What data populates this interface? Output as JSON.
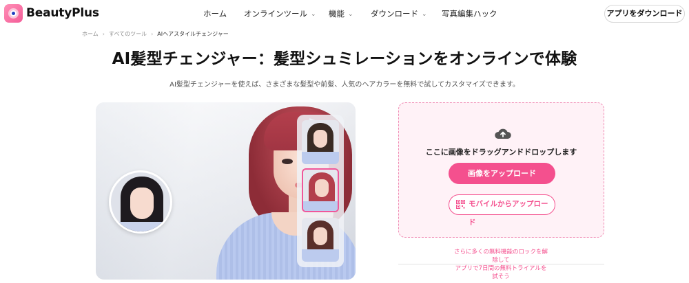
{
  "header": {
    "brand": "BeautyPlus",
    "nav": [
      {
        "label": "ホーム",
        "dropdown": false
      },
      {
        "label": "オンラインツール",
        "dropdown": true
      },
      {
        "label": "機能",
        "dropdown": true
      },
      {
        "label": "ダウンロード",
        "dropdown": true
      },
      {
        "label": "写真編集ハック",
        "dropdown": false
      }
    ],
    "cta_label": "アプリをダウンロード",
    "chevron_glyph": "⌄"
  },
  "breadcrumb": {
    "items": [
      "ホーム",
      "すべてのツール",
      "AIヘアスタイルチェンジャー"
    ],
    "separator": "›"
  },
  "hero": {
    "title": "AI髪型チェンジャー：髪型シュミレーションをオンラインで体験",
    "subtitle": "AI髪型チェンジャーを使えば、さまざまな髪型や前髪、人気のヘアカラーを無料で試してカスタマイズできます。"
  },
  "preview": {
    "thumbnails": [
      {
        "hair_color": "#3a2b24",
        "selected": false
      },
      {
        "hair_color": "#b33f4c",
        "selected": true
      },
      {
        "hair_color": "#5a2f2a",
        "selected": false
      }
    ]
  },
  "upload": {
    "drop_text": "ここに画像をドラッグアンドドロップします",
    "upload_label": "画像をアップロード",
    "mobile_label": "モバイルからアップロード",
    "promo_lines": [
      "さらに多くの無料機能のロックを解",
      "除して",
      "アプリで7日間の無料トライアルを",
      "試そう"
    ]
  },
  "colors": {
    "accent": "#f4508e",
    "panel_bg": "#fff2f7",
    "panel_border": "#f08ab3"
  }
}
